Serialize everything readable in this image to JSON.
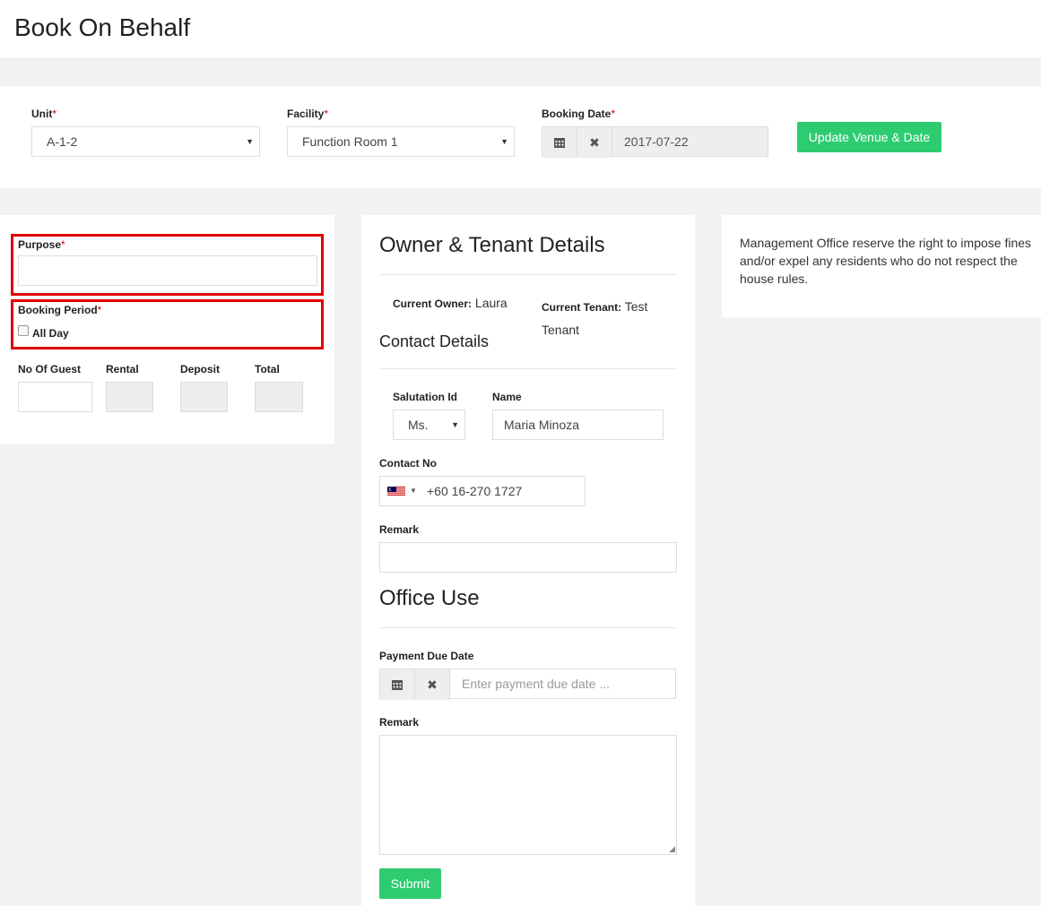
{
  "page": {
    "title": "Book On Behalf"
  },
  "filters": {
    "unit_label": "Unit",
    "unit_value": "A-1-2",
    "facility_label": "Facility",
    "facility_value": "Function Room 1",
    "booking_date_label": "Booking Date",
    "booking_date_value": "2017-07-22",
    "required_mark": "*",
    "update_button": "Update Venue & Date"
  },
  "booking": {
    "purpose_label": "Purpose",
    "booking_period_label": "Booking Period",
    "all_day_label": "All Day",
    "guest_label": "No Of Guest",
    "rental_label": "Rental",
    "deposit_label": "Deposit",
    "total_label": "Total"
  },
  "details": {
    "heading": "Owner & Tenant Details",
    "owner_label": "Current Owner:",
    "owner_value": "Laura",
    "tenant_label": "Current Tenant:",
    "tenant_value_1": "Test",
    "tenant_value_2": "Tenant",
    "contact_heading": "Contact Details",
    "salutation_label": "Salutation Id",
    "salutation_value": "Ms.",
    "name_label": "Name",
    "name_value": "Maria Minoza",
    "contact_label": "Contact No",
    "contact_value": "+60 16-270 1727",
    "remark_label": "Remark",
    "office_heading": "Office Use",
    "payment_due_label": "Payment Due Date",
    "payment_due_placeholder": "Enter payment due date ...",
    "office_remark_label": "Remark",
    "submit_button": "Submit"
  },
  "notice": {
    "line1": "Management Office reserve the right to impose fines",
    "line2": "and/or expel any residents who do not respect the",
    "line3": "house rules."
  },
  "colors": {
    "accent": "#2ecc71",
    "highlight": "#e00000",
    "required": "#cc0000"
  }
}
